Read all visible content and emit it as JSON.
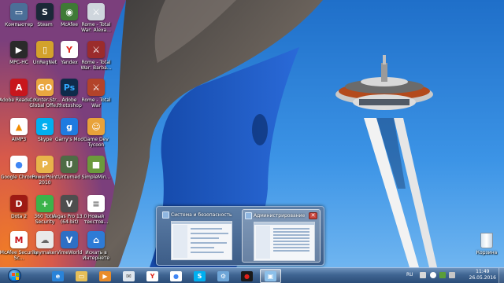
{
  "desktop_icons": [
    {
      "label": "Компьютер",
      "icon": "computer-icon",
      "bg": "#4b6f98",
      "glyph": "▭"
    },
    {
      "label": "Steam",
      "icon": "steam-icon",
      "bg": "#1b2838",
      "glyph": "S"
    },
    {
      "label": "McAfee",
      "icon": "mcafee-badge-icon",
      "bg": "#3f7a36",
      "glyph": "◉"
    },
    {
      "label": "Rome - Total War: Alexa...",
      "icon": "rome-total-war-alexander-icon",
      "bg": "#cfd6dd",
      "glyph": "⚔"
    },
    {
      "label": "MPC-HC",
      "icon": "mpc-hc-icon",
      "bg": "#2a2a2a",
      "glyph": "▶"
    },
    {
      "label": "UnRegNet",
      "icon": "unregnet-icon",
      "bg": "#d3a22b",
      "glyph": "▯"
    },
    {
      "label": "Yandex",
      "icon": "yandex-icon",
      "bg": "#ffffff",
      "glyph": "Y",
      "color": "#e02a1e"
    },
    {
      "label": "Rome - Total War: Barba...",
      "icon": "rome-total-war-barbarian-icon",
      "bg": "#9b2c2c",
      "glyph": "⚔"
    },
    {
      "label": "Adobe Reader XI",
      "icon": "adobe-reader-icon",
      "bg": "#c8161d",
      "glyph": "A"
    },
    {
      "label": "Counter-Str... Global Offe...",
      "icon": "csgo-icon",
      "bg": "#e9a640",
      "glyph": "GO"
    },
    {
      "label": "Adobe Photoshop",
      "icon": "photoshop-icon",
      "bg": "#0f2a4a",
      "glyph": "Ps",
      "color": "#31a8ff"
    },
    {
      "label": "Rome - Total War",
      "icon": "rome-total-war-icon",
      "bg": "#b3432a",
      "glyph": "⚔"
    },
    {
      "label": "AIMP3",
      "icon": "aimp-icon",
      "bg": "#ffffff",
      "glyph": "▲",
      "color": "#f28c00"
    },
    {
      "label": "Skype",
      "icon": "skype-icon",
      "bg": "#00aff0",
      "glyph": "S"
    },
    {
      "label": "Garry's Mod",
      "icon": "garrys-mod-icon",
      "bg": "#1f7be0",
      "glyph": "g"
    },
    {
      "label": "Game Dev Tycoon",
      "icon": "game-dev-tycoon-icon",
      "bg": "#e8a23a",
      "glyph": "☺"
    },
    {
      "label": "Google Chrome",
      "icon": "chrome-icon",
      "bg": "#ffffff",
      "glyph": "●",
      "color": "#3f86f4"
    },
    {
      "label": "PowerPoint 2010",
      "icon": "powerpoint-folder-icon",
      "bg": "#e8b44a",
      "glyph": "P"
    },
    {
      "label": "Unturned",
      "icon": "unturned-icon",
      "bg": "#4e6b45",
      "glyph": "U"
    },
    {
      "label": "SimpleMin...",
      "icon": "minecraft-icon",
      "bg": "#6b9a3c",
      "glyph": "■"
    },
    {
      "label": "Dota 2",
      "icon": "dota2-icon",
      "bg": "#9e1a14",
      "glyph": "D"
    },
    {
      "label": "360 Total Security",
      "icon": "360-total-security-icon",
      "bg": "#3cb34a",
      "glyph": "+"
    },
    {
      "label": "Vegas Pro 13.0 (64-bit)",
      "icon": "vegas-pro-icon",
      "bg": "#4e4e4e",
      "glyph": "V"
    },
    {
      "label": "Новый текстов...",
      "icon": "text-document-icon",
      "bg": "#ffffff",
      "glyph": "≡",
      "color": "#6a6a6a"
    },
    {
      "label": "McAfee Security Sc...",
      "icon": "mcafee-security-scan-icon",
      "bg": "#ffffff",
      "glyph": "M",
      "color": "#c8161d"
    },
    {
      "label": "keymaker",
      "icon": "keymaker-icon",
      "bg": "#e9e9e9",
      "glyph": "☁",
      "color": "#666"
    },
    {
      "label": "VimeWorld",
      "icon": "vimeworld-icon",
      "bg": "#2e6fc4",
      "glyph": "V"
    },
    {
      "label": "Искать в Интернете",
      "icon": "search-internet-icon",
      "bg": "#2e7bd6",
      "glyph": "⌂"
    }
  ],
  "recycle_bin": {
    "label": "Корзина"
  },
  "thumbnail_popup": {
    "windows": [
      {
        "title": "Система и безопасность",
        "active": false
      },
      {
        "title": "Администрирование",
        "active": true,
        "close_label": "✕"
      }
    ]
  },
  "taskbar": {
    "pinned": [
      {
        "name": "taskbar-ie",
        "icon": "internet-explorer-icon",
        "bg": "#2a83d8",
        "glyph": "e"
      },
      {
        "name": "taskbar-explorer",
        "icon": "folder-icon",
        "bg": "#e6bf58",
        "glyph": "▭"
      },
      {
        "name": "taskbar-media-player",
        "icon": "media-player-icon",
        "bg": "#e98c2a",
        "glyph": "▶"
      },
      {
        "name": "taskbar-mail",
        "icon": "mail-icon",
        "bg": "#dfe7ef",
        "glyph": "✉",
        "color": "#555"
      },
      {
        "name": "taskbar-yandex",
        "icon": "yandex-icon",
        "bg": "#ffffff",
        "glyph": "Y",
        "color": "#e02a1e"
      },
      {
        "name": "taskbar-chrome",
        "icon": "chrome-icon",
        "bg": "#ffffff",
        "glyph": "●",
        "color": "#3f86f4"
      },
      {
        "name": "taskbar-skype",
        "icon": "skype-icon",
        "bg": "#00aff0",
        "glyph": "S"
      },
      {
        "name": "taskbar-settings",
        "icon": "gear-icon",
        "bg": "#6ea6d8",
        "glyph": "⚙"
      },
      {
        "name": "taskbar-record",
        "icon": "record-icon",
        "bg": "#1a1a1a",
        "glyph": "●",
        "color": "#e0201a"
      },
      {
        "name": "taskbar-control-panel",
        "icon": "control-panel-icon",
        "bg": "#8cc0ea",
        "glyph": "▣",
        "active": true
      }
    ],
    "tray": {
      "language": "RU",
      "time": "11:49",
      "date": "26.05.2016"
    }
  },
  "colors": {
    "sky": "#2f86dc",
    "needle_top": "#b34a1c"
  }
}
